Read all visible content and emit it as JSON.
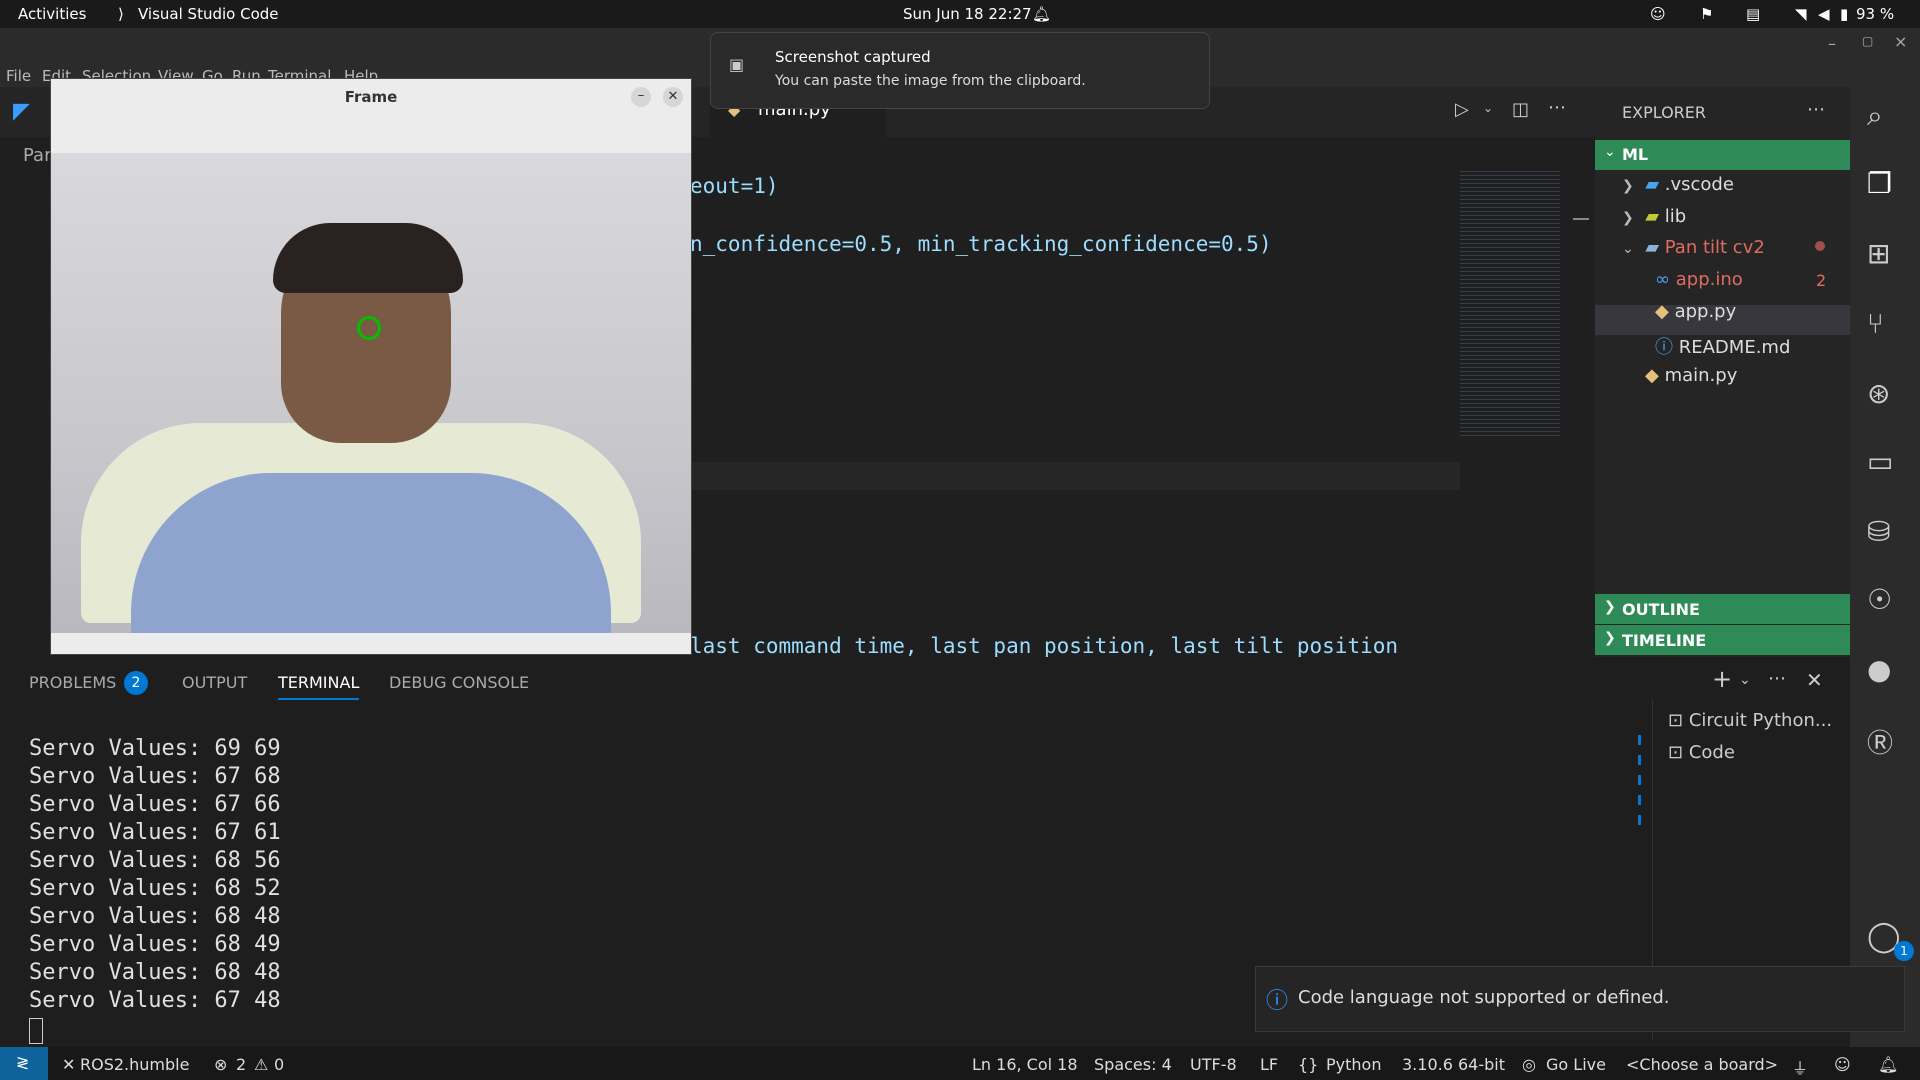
{
  "topbar": {
    "activities": "Activities",
    "app": "Visual Studio Code",
    "datetime": "Sun Jun 18  22:27",
    "battery": "93 %"
  },
  "menu": [
    "File",
    "Edit",
    "Selection",
    "View",
    "Go",
    "Run",
    "Terminal",
    "Help"
  ],
  "editor": {
    "tab_label": "main.py",
    "breadcrumb": "Par",
    "lines": [
      "eout=1)",
      "n_confidence=0.5, min_tracking_confidence=0.5)",
      "last_command_time, last_pan_position, last_tilt_position"
    ]
  },
  "explorer": {
    "title": "EXPLORER",
    "root": "ML",
    "items": [
      {
        "label": ".vscode"
      },
      {
        "label": "lib"
      },
      {
        "label": "Pan tilt cv2"
      },
      {
        "label": "app.ino",
        "badge": "2"
      },
      {
        "label": "app.py"
      },
      {
        "label": "README.md"
      },
      {
        "label": "main.py"
      }
    ],
    "outline": "OUTLINE",
    "timeline": "TIMELINE"
  },
  "panel": {
    "tabs": [
      "PROBLEMS",
      "OUTPUT",
      "TERMINAL",
      "DEBUG CONSOLE"
    ],
    "problems_count": "2",
    "terminal_lines": [
      "Servo Values: 69 69",
      "Servo Values: 67 68",
      "Servo Values: 67 66",
      "Servo Values: 67 61",
      "Servo Values: 68 56",
      "Servo Values: 68 52",
      "Servo Values: 68 48",
      "Servo Values: 68 49",
      "Servo Values: 68 48",
      "Servo Values: 67 48"
    ],
    "terminals": [
      "Circuit Python...",
      "Code"
    ]
  },
  "frame": {
    "title": "Frame"
  },
  "notification": {
    "title": "Screenshot captured",
    "body": "You can paste the image from the clipboard."
  },
  "toast": {
    "message": "Code language not supported or defined."
  },
  "statusbar": {
    "remote": "ROS2.humble",
    "errors": "2",
    "warnings": "0",
    "position": "Ln 16, Col 18",
    "spaces": "Spaces: 4",
    "encoding": "UTF-8",
    "eol": "LF",
    "language": "Python",
    "interpreter": "3.10.6 64-bit",
    "golive": "Go Live",
    "board": "<Choose a board>"
  },
  "account_badge": "1",
  "colors": {
    "accent": "#2e8b57",
    "badge": "#0078d4",
    "modified": "#e06c60"
  }
}
